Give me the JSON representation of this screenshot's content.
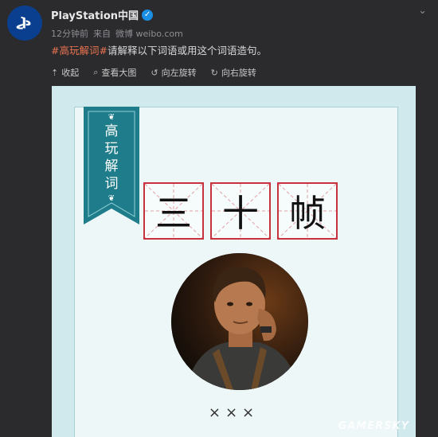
{
  "post": {
    "username": "PlayStation中国",
    "verified_icon": "verified-badge-icon",
    "time": "12分钟前",
    "source_prefix": "来自",
    "source": "微博 weibo.com",
    "hashtag": "#高玩解词#",
    "text": "请解释以下词语或用这个词语造句。"
  },
  "toolbar": {
    "collapse": "收起",
    "view_large": "查看大图",
    "rotate_left": "向左旋转",
    "rotate_right": "向右旋转"
  },
  "card": {
    "ribbon_text": "高\n玩\n解\n词",
    "chars": [
      "三",
      "十",
      "帧"
    ],
    "bottom_marks": "×××",
    "watermark": "GAMERSKY",
    "colors": {
      "background": "#cfe9ec",
      "ribbon": "#1f7c8a",
      "grid_border": "#c8323e"
    }
  }
}
